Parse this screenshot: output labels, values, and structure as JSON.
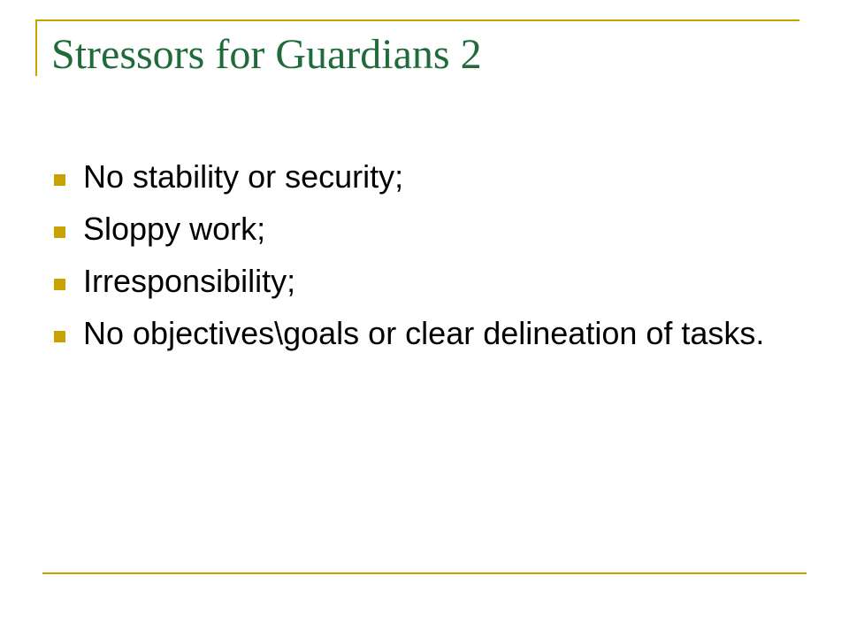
{
  "slide": {
    "title": "Stressors for Guardians 2",
    "bullets": [
      "No stability or security;",
      "Sloppy work;",
      "Irresponsibility;",
      "No objectives\\goals or clear delineation of tasks."
    ]
  },
  "colors": {
    "accent": "#c8a200",
    "title": "#1f6b3a",
    "text": "#000000",
    "background": "#ffffff"
  },
  "icons": {
    "bullet_marker": "square-bullet-icon"
  }
}
